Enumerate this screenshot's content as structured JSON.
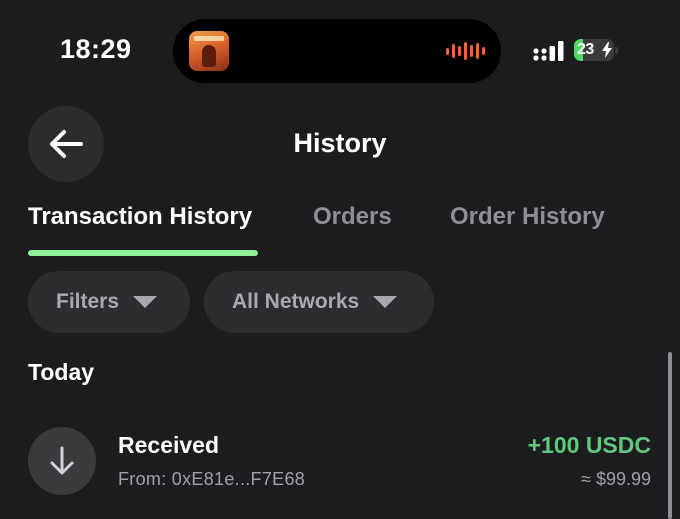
{
  "status_bar": {
    "time": "18:29",
    "battery_level": "23",
    "battery_charging": true,
    "now_playing_icon": "album-art",
    "audio_icon": "waveform-icon",
    "signal_icon": "cellular-signal-icon"
  },
  "header": {
    "back_icon": "arrow-left-icon",
    "title": "History"
  },
  "tabs": [
    {
      "label": "Transaction History",
      "active": true
    },
    {
      "label": "Orders",
      "active": false
    },
    {
      "label": "Order History",
      "active": false
    }
  ],
  "filters": {
    "filters_label": "Filters",
    "networks_label": "All Networks",
    "dropdown_icon": "caret-down-icon"
  },
  "sections": [
    {
      "heading": "Today",
      "transactions": [
        {
          "type_icon": "arrow-down-icon",
          "title": "Received",
          "subtitle": "From: 0xE81e...F7E68",
          "amount": "+100 USDC",
          "fiat": "≈ $99.99"
        }
      ]
    }
  ],
  "colors": {
    "background": "#1c1c1e",
    "surface": "#2c2c2e",
    "accent_underline": "#8ff09a",
    "positive_amount": "#5fc97b",
    "muted_text": "#8e8e93",
    "battery_fill": "#4cd964",
    "waveform": "#e8643a"
  }
}
